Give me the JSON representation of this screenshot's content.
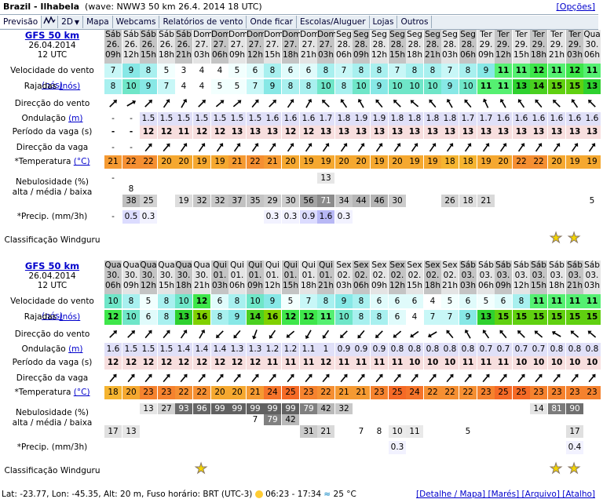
{
  "header": {
    "place": "Brazil - Ilhabela",
    "wave_note": "(wave: NWW3 50 km 26.4. 2014 18 UTC)",
    "options": "[Opções]"
  },
  "tabs": [
    {
      "label": "Previsão",
      "icon": ""
    },
    {
      "label": "",
      "icon": "graph-icon"
    },
    {
      "label": "2D",
      "icon": "dropdown"
    },
    {
      "label": "Mapa",
      "icon": ""
    },
    {
      "label": "Webcams",
      "icon": ""
    },
    {
      "label": "Relatórios de vento",
      "icon": ""
    },
    {
      "label": "Onde ficar",
      "icon": ""
    },
    {
      "label": "Escolas/Aluguer",
      "icon": ""
    },
    {
      "label": "Lojas",
      "icon": ""
    },
    {
      "label": "Outros",
      "icon": ""
    }
  ],
  "labels": {
    "model": "GFS 50 km",
    "date": "26.04.2014",
    "utc": "12 UTC",
    "wind_speed": "Velocidade do vento",
    "wind_speed_unit": "(nós)",
    "gusts": "Rajadas",
    "gusts_unit": "(nós)",
    "wind_dir": "Direcção do vento",
    "swell": "Ondulação",
    "swell_unit": "(m)",
    "wave_period": "Período da vaga (s)",
    "wave_dir": "Direcção da vaga",
    "temp": "*Temperatura",
    "temp_unit": "(°C)",
    "cloud1": "Nebulosidade (%)",
    "cloud2": "alta / média / baixa",
    "precip": "*Precip. (mm/3h)",
    "rating": "Classificação Windguru"
  },
  "colors": {
    "header_dark": "#b8b8b8",
    "header_light": "#dcdcdc",
    "wave_row": "#f7dede",
    "swell_row": "#e0e0f8",
    "temp_hot": "#f58c32",
    "temp_warm": "#f5b430"
  },
  "blocks": [
    {
      "days": [
        "Sáb",
        "Sáb",
        "Sáb",
        "Sáb",
        "Sáb",
        "Dom",
        "Dom",
        "Dom",
        "Dom",
        "Dom",
        "Dom",
        "Dom",
        "Dom",
        "Seg",
        "Seg",
        "Seg",
        "Seg",
        "Seg",
        "Seg",
        "Seg",
        "Seg",
        "Ter",
        "Ter",
        "Ter",
        "Ter",
        "Ter",
        "Ter",
        "Qua"
      ],
      "dates": [
        "26.",
        "26.",
        "26.",
        "26.",
        "26.",
        "27.",
        "27.",
        "27.",
        "27.",
        "27.",
        "27.",
        "27.",
        "27.",
        "28.",
        "28.",
        "28.",
        "28.",
        "28.",
        "28.",
        "28.",
        "28.",
        "29.",
        "29.",
        "29.",
        "29.",
        "29.",
        "29.",
        "30."
      ],
      "hours": [
        "09h",
        "12h",
        "15h",
        "18h",
        "21h",
        "03h",
        "06h",
        "09h",
        "12h",
        "15h",
        "18h",
        "21h",
        "03h",
        "06h",
        "09h",
        "12h",
        "15h",
        "18h",
        "21h",
        "03h",
        "06h",
        "09h",
        "12h",
        "15h",
        "18h",
        "21h",
        "03h",
        "06h"
      ],
      "wind": [
        7,
        9,
        8,
        5,
        3,
        4,
        4,
        5,
        6,
        8,
        6,
        6,
        8,
        7,
        8,
        8,
        7,
        8,
        8,
        7,
        8,
        9,
        11,
        11,
        12,
        11,
        12,
        11
      ],
      "gust": [
        8,
        10,
        9,
        7,
        4,
        4,
        5,
        5,
        7,
        9,
        8,
        8,
        10,
        8,
        10,
        9,
        10,
        10,
        10,
        9,
        10,
        11,
        11,
        13,
        14,
        15,
        15,
        13
      ],
      "wdir": [
        45,
        60,
        45,
        35,
        30,
        45,
        50,
        50,
        40,
        45,
        35,
        30,
        315,
        325,
        330,
        320,
        315,
        310,
        320,
        330,
        320,
        335,
        330,
        325,
        320,
        315,
        325,
        315
      ],
      "swell": [
        "-",
        "-",
        "1.5",
        "1.5",
        "1.5",
        "1.5",
        "1.5",
        "1.5",
        "1.5",
        "1.6",
        "1.6",
        "1.6",
        "1.7",
        "1.8",
        "1.9",
        "1.9",
        "1.8",
        "1.8",
        "1.8",
        "1.8",
        "1.7",
        "1.7",
        "1.6",
        "1.6",
        "1.6",
        "1.6",
        "1.6",
        "1.6"
      ],
      "period": [
        "-",
        "-",
        "12",
        "12",
        "11",
        "12",
        "12",
        "13",
        "13",
        "13",
        "12",
        "12",
        "13",
        "13",
        "13",
        "13",
        "13",
        "13",
        "13",
        "13",
        "13",
        "13",
        "13",
        "13",
        "13",
        "13",
        "13",
        "13"
      ],
      "wvdir": [
        null,
        null,
        40,
        40,
        35,
        35,
        35,
        35,
        35,
        35,
        35,
        35,
        35,
        35,
        35,
        35,
        35,
        35,
        35,
        35,
        35,
        35,
        35,
        35,
        35,
        35,
        35,
        35
      ],
      "temp": [
        21,
        22,
        22,
        20,
        20,
        19,
        19,
        21,
        22,
        21,
        20,
        19,
        19,
        20,
        20,
        19,
        20,
        19,
        19,
        18,
        18,
        19,
        20,
        22,
        22,
        20,
        19,
        19
      ],
      "cloud_hi": [
        "-",
        "",
        "",
        "",
        "",
        "",
        "",
        "",
        "",
        "",
        "",
        "",
        "13",
        "",
        "",
        "",
        "",
        "",
        "",
        "",
        "",
        "",
        "",
        "",
        "",
        "",
        "",
        ""
      ],
      "cloud_mid": [
        "",
        "8",
        "",
        "",
        "",
        "",
        "",
        "",
        "",
        "",
        "",
        "",
        "",
        "",
        "",
        "",
        "",
        "",
        "",
        "",
        "",
        "",
        "",
        "",
        "",
        "",
        "",
        ""
      ],
      "cloud_lo": [
        "",
        "38",
        "25",
        "",
        "19",
        "32",
        "32",
        "37",
        "35",
        "29",
        "30",
        "56",
        "71",
        "34",
        "44",
        "46",
        "30",
        "",
        "",
        "26",
        "18",
        "21",
        "",
        "",
        "",
        "",
        "",
        "5"
      ],
      "precip": [
        "-",
        "0.5",
        "0.3",
        "",
        "",
        "",
        "",
        "",
        "",
        "0.3",
        "0.3",
        "0.9",
        "1.6",
        "0.3",
        "",
        "",
        "",
        "",
        "",
        "",
        "",
        "",
        "",
        "",
        "",
        "",
        "",
        ""
      ],
      "stars": [
        0,
        0,
        0,
        0,
        0,
        0,
        0,
        0,
        0,
        0,
        0,
        0,
        0,
        0,
        0,
        0,
        0,
        0,
        0,
        0,
        0,
        0,
        0,
        0,
        0,
        1,
        1,
        0
      ]
    },
    {
      "days": [
        "Qua",
        "Qua",
        "Qua",
        "Qua",
        "Qua",
        "Qua",
        "Qui",
        "Qui",
        "Qui",
        "Qui",
        "Qui",
        "Qui",
        "Qui",
        "Sex",
        "Sex",
        "Sex",
        "Sex",
        "Sex",
        "Sex",
        "Sex",
        "Sáb",
        "Sáb",
        "Sáb",
        "Sáb",
        "Sáb",
        "Sáb",
        "Sáb",
        "Sáb"
      ],
      "dates": [
        "30.",
        "30.",
        "30.",
        "30.",
        "30.",
        "30.",
        "01.",
        "01.",
        "01.",
        "01.",
        "01.",
        "01.",
        "01.",
        "02.",
        "02.",
        "02.",
        "02.",
        "02.",
        "02.",
        "02.",
        "03.",
        "03.",
        "03.",
        "03.",
        "03.",
        "03.",
        "03.",
        "03."
      ],
      "hours": [
        "06h",
        "09h",
        "12h",
        "15h",
        "18h",
        "21h",
        "03h",
        "06h",
        "09h",
        "12h",
        "15h",
        "18h",
        "21h",
        "03h",
        "06h",
        "09h",
        "12h",
        "15h",
        "18h",
        "21h",
        "03h",
        "06h",
        "09h",
        "12h",
        "15h",
        "18h",
        "21h",
        "03h"
      ],
      "wind": [
        10,
        8,
        5,
        8,
        10,
        12,
        6,
        8,
        10,
        9,
        5,
        7,
        8,
        9,
        8,
        6,
        6,
        6,
        4,
        5,
        6,
        5,
        6,
        8,
        11,
        11,
        11,
        11
      ],
      "gust": [
        12,
        10,
        6,
        8,
        13,
        16,
        8,
        9,
        14,
        16,
        12,
        12,
        11,
        10,
        8,
        8,
        6,
        4,
        7,
        7,
        9,
        13,
        15,
        15,
        15,
        15,
        15,
        15
      ],
      "wdir": [
        45,
        45,
        40,
        40,
        35,
        30,
        225,
        220,
        200,
        215,
        230,
        210,
        215,
        225,
        220,
        225,
        230,
        235,
        240,
        320,
        330,
        325,
        320,
        315,
        310,
        300,
        310,
        310
      ],
      "swell": [
        "1.6",
        "1.5",
        "1.5",
        "1.5",
        "1.4",
        "1.4",
        "1.4",
        "1.3",
        "1.3",
        "1.2",
        "1.2",
        "1.1",
        "1",
        "0.9",
        "0.9",
        "0.9",
        "0.8",
        "0.8",
        "0.8",
        "0.8",
        "0.8",
        "0.7",
        "0.7",
        "0.7",
        "0.7",
        "0.8",
        "0.8",
        "0.8"
      ],
      "period": [
        "12",
        "12",
        "12",
        "12",
        "12",
        "12",
        "12",
        "12",
        "12",
        "11",
        "11",
        "11",
        "12",
        "11",
        "11",
        "11",
        "11",
        "10",
        "10",
        "10",
        "11",
        "11",
        "11",
        "10",
        "10",
        "10",
        "10",
        "10"
      ],
      "wvdir": [
        40,
        40,
        40,
        40,
        40,
        40,
        40,
        40,
        40,
        40,
        40,
        40,
        40,
        40,
        40,
        40,
        40,
        40,
        40,
        40,
        40,
        40,
        40,
        40,
        40,
        40,
        40,
        40
      ],
      "temp": [
        18,
        20,
        23,
        23,
        22,
        22,
        20,
        20,
        21,
        24,
        25,
        23,
        22,
        21,
        21,
        23,
        25,
        24,
        22,
        22,
        22,
        23,
        25,
        25,
        23,
        23,
        23,
        23
      ],
      "cloud_hi": [
        "",
        "",
        "13",
        "27",
        "93",
        "96",
        "99",
        "99",
        "99",
        "99",
        "99",
        "79",
        "42",
        "32",
        "",
        "",
        "",
        "",
        "",
        "",
        "",
        "",
        "",
        "",
        "14",
        "81",
        "90",
        ""
      ],
      "cloud_mid": [
        "",
        "",
        "",
        "",
        "",
        "",
        "",
        "",
        "7",
        "79",
        "42",
        "",
        "",
        "",
        "",
        "",
        "",
        "",
        "",
        "",
        "",
        "",
        "",
        "",
        "",
        "",
        "",
        ""
      ],
      "cloud_lo": [
        "17",
        "13",
        "",
        "",
        "",
        "",
        "",
        "",
        "",
        "",
        "",
        "31",
        "21",
        "",
        "7",
        "8",
        "10",
        "11",
        "",
        "",
        "5",
        "",
        "",
        "",
        "",
        "",
        "17",
        ""
      ],
      "precip": [
        "",
        "",
        "",
        "",
        "",
        "",
        "",
        "",
        "",
        "",
        "",
        "",
        "",
        "",
        "",
        "",
        "0.3",
        "",
        "",
        "",
        "",
        "",
        "",
        "",
        "",
        "",
        "0.4",
        ""
      ],
      "stars": [
        0,
        0,
        0,
        0,
        0,
        1,
        0,
        0,
        0,
        0,
        0,
        0,
        0,
        0,
        0,
        0,
        0,
        0,
        0,
        0,
        0,
        0,
        0,
        0,
        0,
        1,
        1,
        0
      ]
    }
  ],
  "footer": {
    "lat": "Lat: -23.77",
    "lon": "Lon: -45.35",
    "alt": "Alt: 20 m",
    "tz": "Fuso horário: BRT (UTC-3)",
    "sun": "06:23 - 17:34",
    "water": "25 °C",
    "links": "[Detalhe / Mapa] [Marés] [Arquivo] [Atalho]"
  }
}
